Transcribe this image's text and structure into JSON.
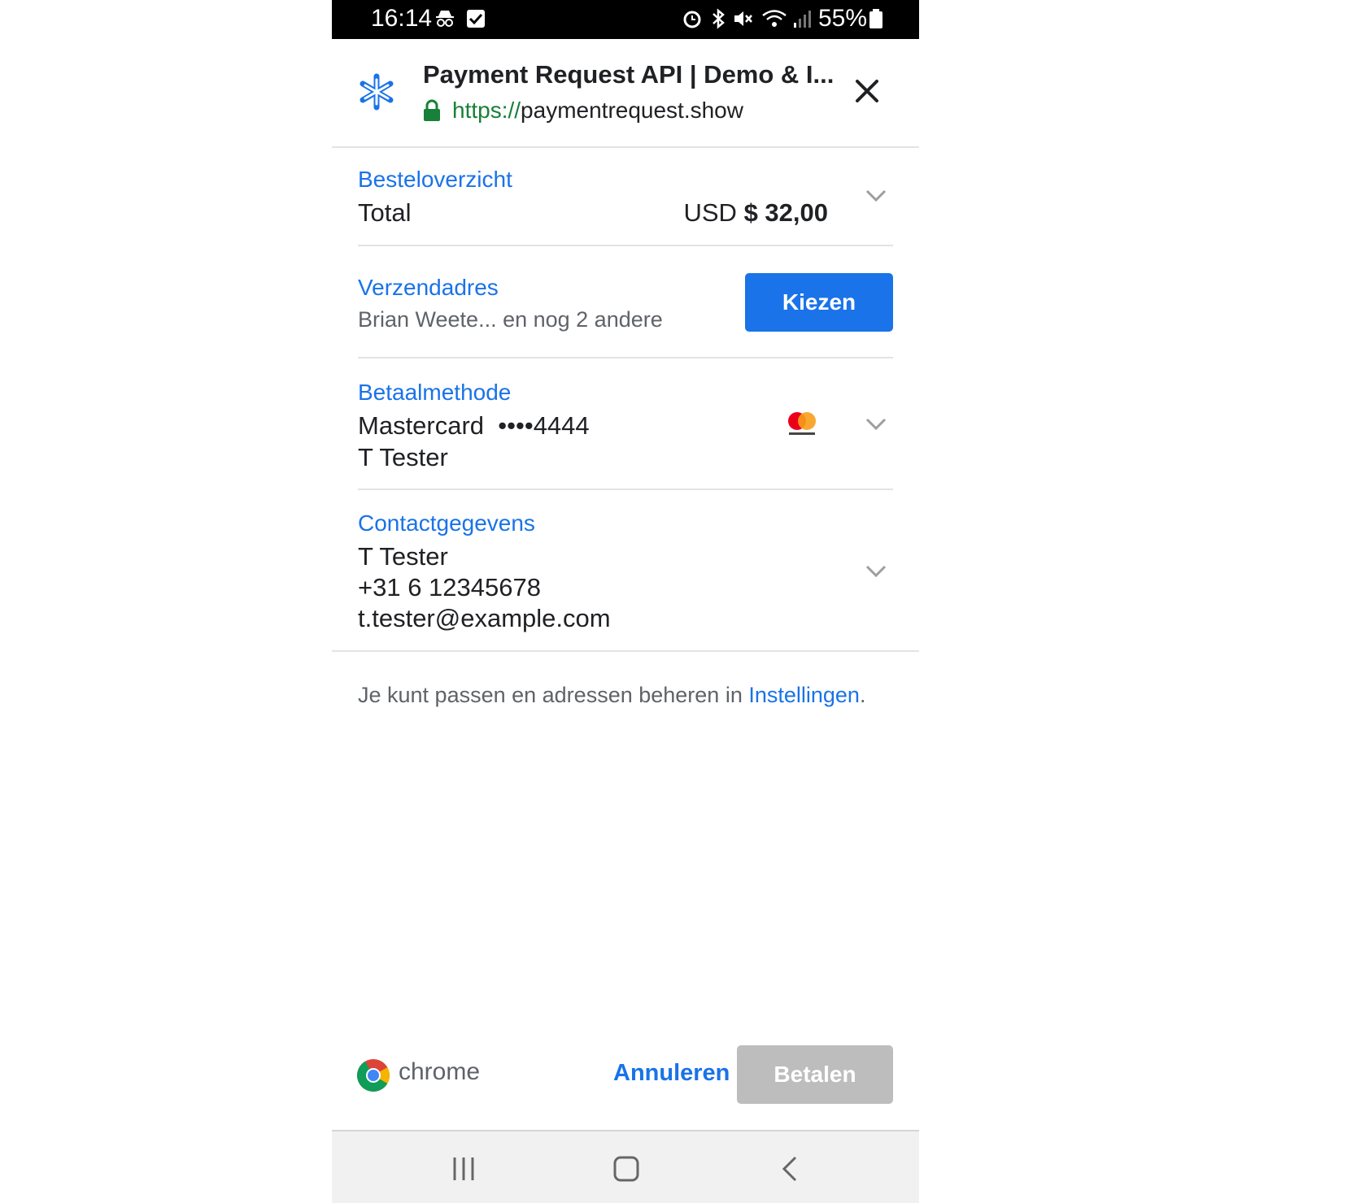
{
  "status_bar": {
    "time": "16:14",
    "battery": "55%",
    "icons": [
      "incognito-icon",
      "checkbox-icon",
      "alarm-icon",
      "bluetooth-icon",
      "mute-icon",
      "wifi-icon",
      "signal-icon",
      "battery-icon"
    ]
  },
  "header": {
    "title": "Payment Request API | Demo & I...",
    "url_scheme": "https://",
    "url_host": "paymentrequest.show",
    "logo_icon": "asterisk-logo-icon",
    "close_icon": "close-icon"
  },
  "order_summary": {
    "title": "Besteloverzicht",
    "label": "Total",
    "currency": "USD",
    "amount": "$ 32,00"
  },
  "shipping": {
    "title": "Verzendadres",
    "summary": "Brian Weete... en nog 2 andere",
    "button": "Kiezen"
  },
  "payment_method": {
    "title": "Betaalmethode",
    "card": "Mastercard",
    "masked": "••••4444",
    "holder": "T Tester",
    "brand_icon": "mastercard-icon"
  },
  "contact": {
    "title": "Contactgegevens",
    "name": "T Tester",
    "phone": "+31 6 12345678",
    "email": "t.tester@example.com"
  },
  "note": {
    "text": "Je kunt passen en adressen beheren in ",
    "link": "Instellingen",
    "end": "."
  },
  "footer": {
    "brand": "chrome",
    "cancel": "Annuleren",
    "pay": "Betalen"
  },
  "colors": {
    "accent": "#1a73e8",
    "secure": "#188038",
    "disabled": "#bdbdbd"
  }
}
